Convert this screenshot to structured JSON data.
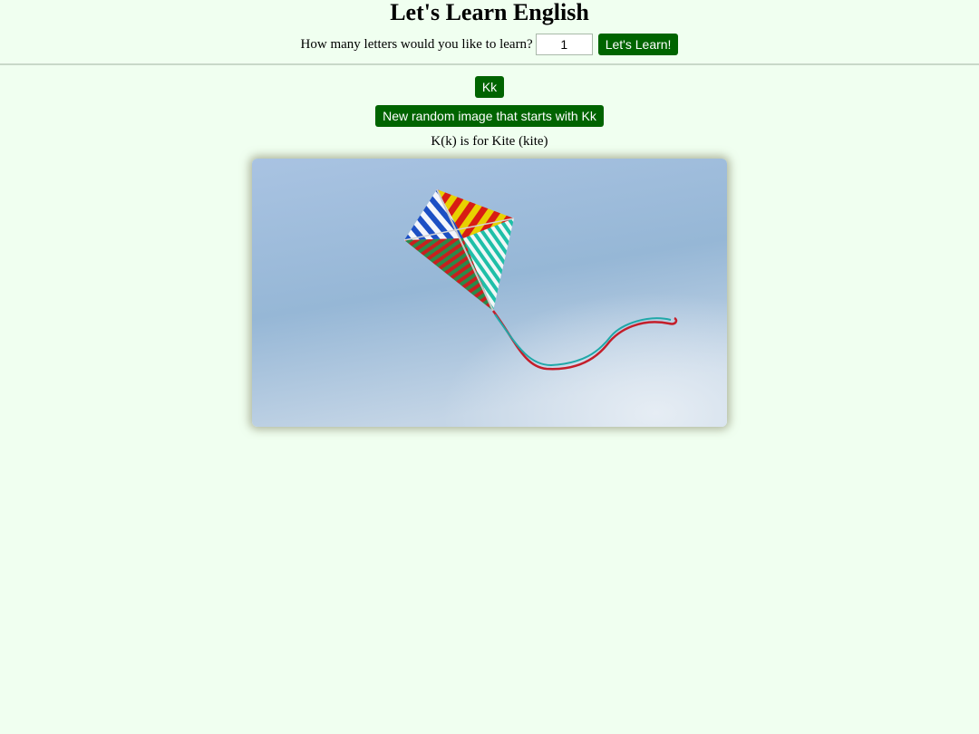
{
  "header": {
    "title": "Let's Learn English",
    "prompt_label": "How many letters would you like to learn?",
    "count_value": "1",
    "learn_button": "Let's Learn!"
  },
  "lesson": {
    "letter_button": "Kk",
    "random_button": "New random image that starts with Kk",
    "caption": "K(k) is for Kite (kite)",
    "image_subject": "kite-photo"
  },
  "colors": {
    "background": "#f0fff0",
    "button": "#006400",
    "sky": "#9ebcdc"
  }
}
